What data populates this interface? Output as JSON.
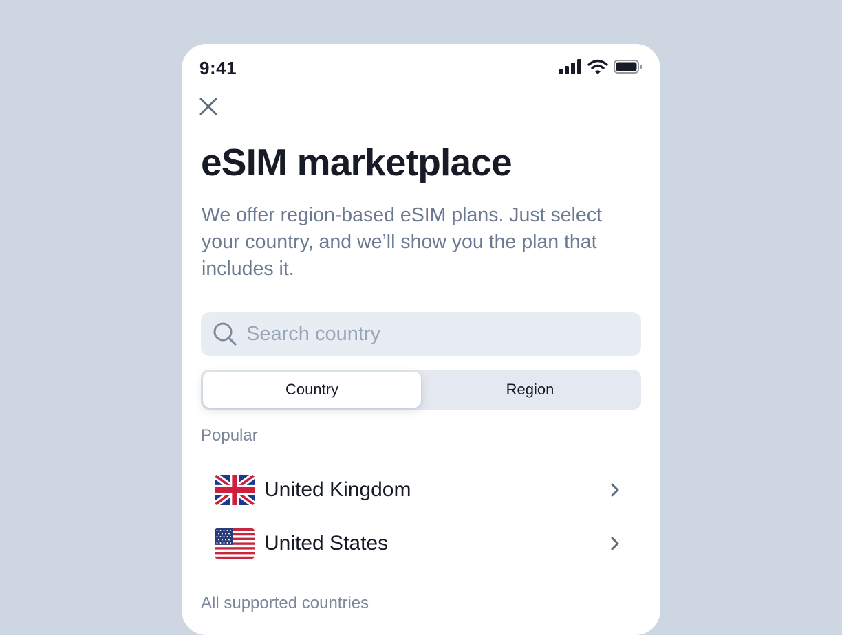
{
  "status_bar": {
    "time": "9:41",
    "icons": [
      "cellular-signal-icon",
      "wifi-icon",
      "battery-icon"
    ]
  },
  "header": {
    "close_icon": "close-icon",
    "title": "eSIM marketplace",
    "description": "We offer region-based eSIM plans. Just select your country, and we’ll show you the plan that includes it."
  },
  "search": {
    "icon": "search-icon",
    "placeholder": "Search country",
    "value": ""
  },
  "segmented_control": {
    "options": [
      {
        "label": "Country",
        "selected": true
      },
      {
        "label": "Region",
        "selected": false
      }
    ]
  },
  "popular": {
    "label": "Popular",
    "countries": [
      {
        "name": "United Kingdom",
        "flag_icon": "uk-flag-icon",
        "chevron_icon": "chevron-right-icon"
      },
      {
        "name": "United States",
        "flag_icon": "us-flag-icon",
        "chevron_icon": "chevron-right-icon"
      }
    ]
  },
  "all_countries": {
    "label": "All supported countries"
  },
  "colors": {
    "background": "#cdd6e1",
    "card": "#ffffff",
    "title_text": "#161b26",
    "body_text": "#6c7a91",
    "search_fill": "#e8ecf3",
    "placeholder": "#9aa6b8",
    "segment_track": "#e4e9f1"
  }
}
